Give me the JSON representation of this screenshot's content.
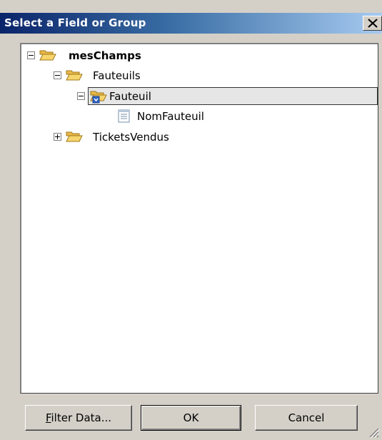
{
  "window": {
    "title": "Select a Field or Group",
    "close_glyph": "✕"
  },
  "tree": {
    "root": {
      "label": "mesChamps",
      "icon": "folder-open-icon",
      "expanded": true
    },
    "group_fauteuils": {
      "label": "Fauteuils",
      "icon": "folder-open-icon",
      "expanded": true
    },
    "group_fauteuil": {
      "label": "Fauteuil",
      "icon": "repeating-group-icon",
      "expanded": true,
      "selected": true
    },
    "field_nomfauteuil": {
      "label": "NomFauteuil",
      "icon": "field-icon"
    },
    "group_ticketsvendus": {
      "label": "TicketsVendus",
      "icon": "folder-open-icon",
      "expanded": false
    }
  },
  "buttons": {
    "filter_prefix": "F",
    "filter_rest": "ilter Data...",
    "ok": "OK",
    "cancel": "Cancel"
  }
}
